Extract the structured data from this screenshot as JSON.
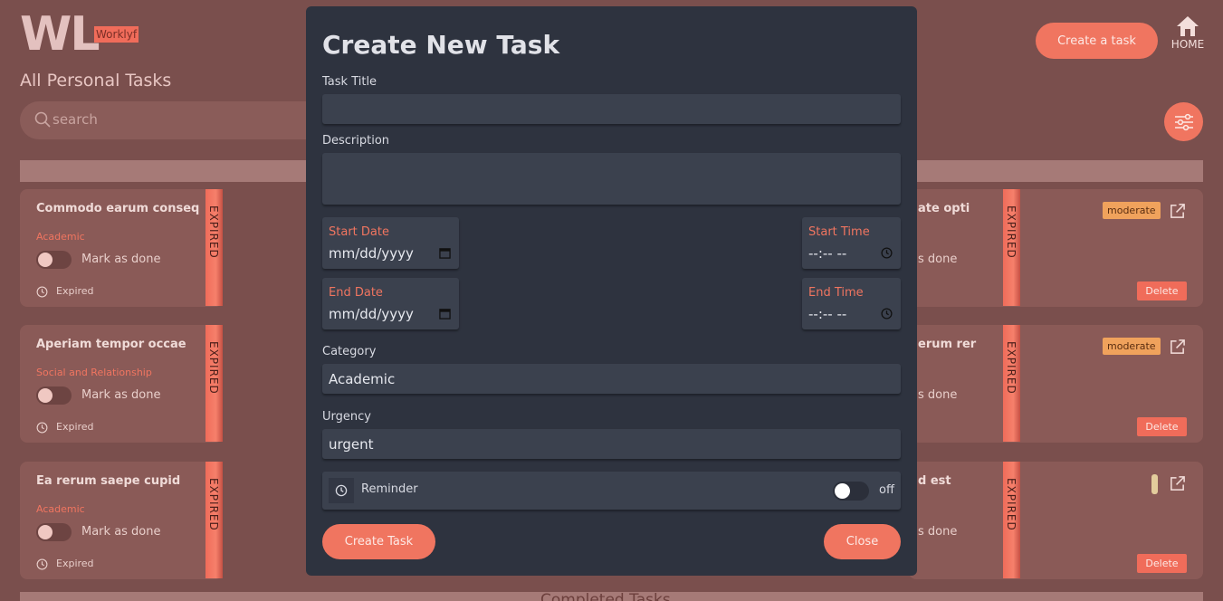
{
  "app": {
    "logo": "WL",
    "logo_badge": "Worklyf"
  },
  "header": {
    "heading": "All Personal Tasks",
    "create_button": "Create a task",
    "home_label": "HOME"
  },
  "search": {
    "placeholder": "search"
  },
  "bottom_strip": {
    "label": "Completed Tasks"
  },
  "left_cards": [
    {
      "title": "Commodo earum conseq",
      "category": "Academic",
      "toggle_label": "Mark as done",
      "status": "Expired",
      "bar_label": "EXPIRED"
    },
    {
      "title": "Aperiam tempor occae",
      "category": "Social and Relationship",
      "toggle_label": "Mark as done",
      "status": "Expired",
      "bar_label": "EXPIRED"
    },
    {
      "title": "Ea rerum saepe cupid",
      "category": "Academic",
      "toggle_label": "Mark as done",
      "status": "Expired",
      "bar_label": "EXPIRED"
    }
  ],
  "right_cards": [
    {
      "title_tail": "ate opti",
      "done_tail": "s done",
      "badge": "moderate",
      "delete_label": "Delete",
      "bar_label": "EXPIRED"
    },
    {
      "title_tail": "erum rer",
      "done_tail": "s done",
      "badge": "moderate",
      "delete_label": "Delete",
      "bar_label": "EXPIRED"
    },
    {
      "title_tail": "d est",
      "done_tail": "s done",
      "badge": "",
      "delete_label": "Delete",
      "bar_label": "EXPIRED"
    }
  ],
  "modal": {
    "title": "Create New Task",
    "task_title_label": "Task Title",
    "task_title_value": "",
    "description_label": "Description",
    "description_value": "",
    "start_date_label": "Start Date",
    "start_date_value": "mm/dd/yyyy",
    "start_time_label": "Start Time",
    "start_time_value": "--:-- --",
    "end_date_label": "End Date",
    "end_date_value": "mm/dd/yyyy",
    "end_time_label": "End Time",
    "end_time_value": "--:-- --",
    "category_label": "Category",
    "category_value": "Academic",
    "urgency_label": "Urgency",
    "urgency_value": "urgent",
    "reminder_label": "Reminder",
    "reminder_state": "off",
    "create_button": "Create Task",
    "close_button": "Close"
  },
  "colors": {
    "accent": "#f07560",
    "modal_bg": "#2e333f",
    "field_bg": "#3b414e",
    "page_bg": "#7a4f4d",
    "badge_moderate": "#f0a25c"
  },
  "icons": [
    "search-icon",
    "home-icon",
    "filter-icon",
    "clock-icon",
    "calendar-icon",
    "external-link-icon"
  ]
}
